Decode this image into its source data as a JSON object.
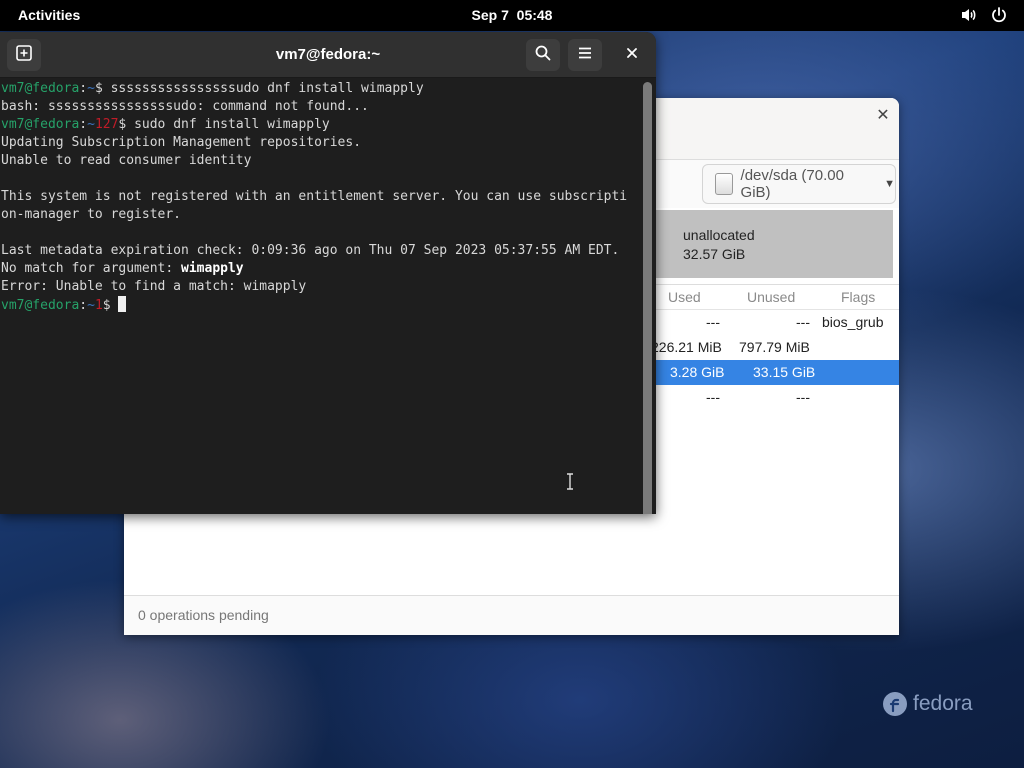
{
  "topbar": {
    "activities": "Activities",
    "date": "Sep 7",
    "time": "05:48",
    "icons": [
      "volume-icon",
      "power-icon"
    ]
  },
  "partition_editor": {
    "device": "/dev/sda (70.00 GiB)",
    "unallocated": {
      "label": "unallocated",
      "size": "32.57 GiB"
    },
    "columns": {
      "used": "Used",
      "unused": "Unused",
      "flags": "Flags"
    },
    "rows": [
      {
        "used": "---",
        "unused": "---",
        "flags": "bios_grub",
        "selected": false
      },
      {
        "used": "226.21 MiB",
        "unused": "797.79 MiB",
        "flags": "",
        "selected": false
      },
      {
        "used": "3.28 GiB",
        "unused": "33.15 GiB",
        "flags": "",
        "selected": true
      },
      {
        "used": "---",
        "unused": "---",
        "flags": "",
        "selected": false
      }
    ],
    "status": "0 operations pending"
  },
  "terminal": {
    "title": "vm7@fedora:~",
    "prompt_user": "vm7@fedora",
    "prompt_sep": ":",
    "prompt_path": "~",
    "prompt_end": "$ ",
    "exit_code_127": "127",
    "exit_code_1": "1",
    "cmd1": "ssssssssssssssssudo dnf install wimapply",
    "out1": "bash: ssssssssssssssssudo: command not found...",
    "cmd2": "sudo dnf install wimapply",
    "out2": "Updating Subscription Management repositories.",
    "out3": "Unable to read consumer identity",
    "out4": "This system is not registered with an entitlement server. You can use subscripti",
    "out5": "on-manager to register.",
    "out6": "Last metadata expiration check: 0:09:36 ago on Thu 07 Sep 2023 05:37:55 AM EDT.",
    "out7_prefix": "No match for argument: ",
    "out7_arg": "wimapply",
    "out8": "Error: Unable to find a match: wimapply"
  },
  "desktop": {
    "logo_text": "fedora"
  }
}
